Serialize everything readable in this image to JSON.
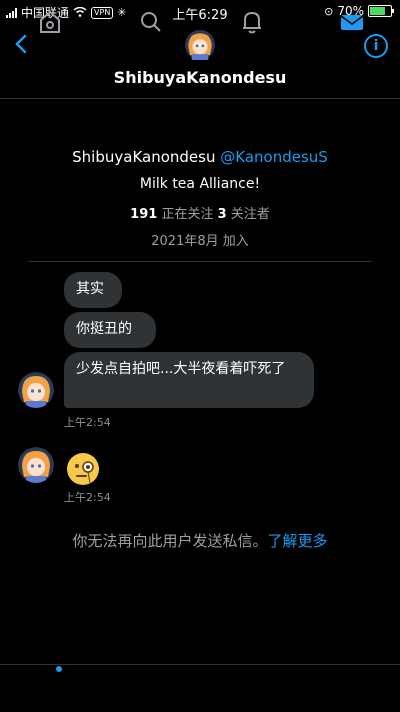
{
  "statusbar": {
    "carrier": "中国联通",
    "vpn": "VPN",
    "time": "上午6:29",
    "battery": "70%"
  },
  "header": {
    "title": "ShibuyaKanondesu",
    "back_icon": "chevron-left-icon",
    "info_icon": "info-icon"
  },
  "profile": {
    "name": "ShibuyaKanondesu",
    "handle": "@KanondesuS",
    "bio": "Milk tea Alliance!",
    "following_count": "191",
    "following_label": "正在关注",
    "followers_count": "3",
    "followers_label": "关注者",
    "joined": "2021年8月 加入"
  },
  "messages": [
    {
      "text": "其实"
    },
    {
      "text": "你挺丑的"
    },
    {
      "text": "少发点自拍吧...大半夜看着吓死了"
    }
  ],
  "timestamps": [
    "上午2:54",
    "上午2:54"
  ],
  "emoji_message": "face-with-monocle-emoji",
  "notice": {
    "text": "你无法再向此用户发送私信。",
    "link": "了解更多"
  },
  "tabbar": {
    "items": [
      "home-icon",
      "search-icon",
      "bell-icon",
      "mail-icon"
    ]
  },
  "colors": {
    "accent": "#1d9bf0",
    "bubble": "#2f3336",
    "background": "#000000"
  }
}
